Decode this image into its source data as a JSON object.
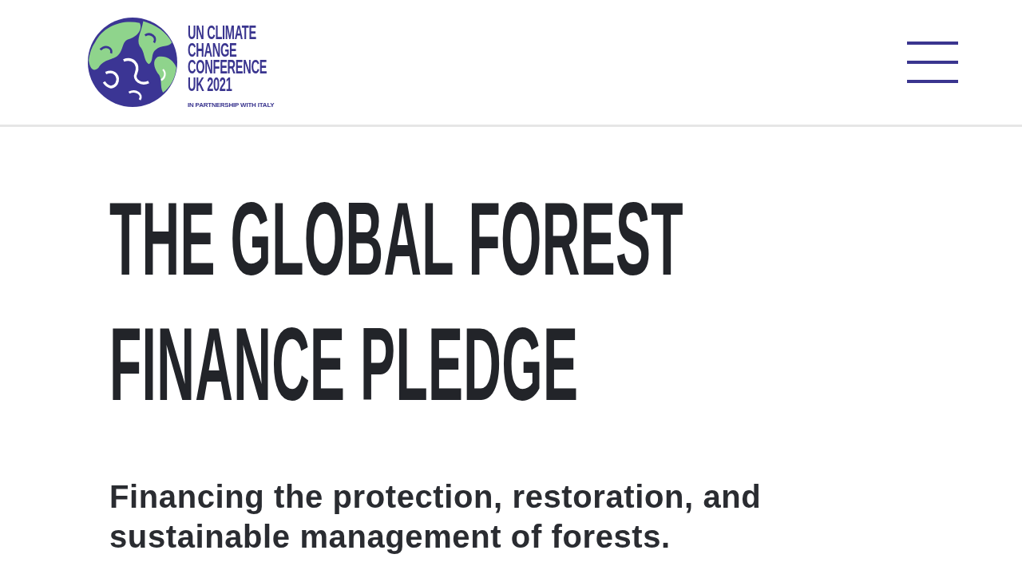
{
  "header": {
    "logo": {
      "lines": [
        "UN CLIMATE",
        "CHANGE",
        "CONFERENCE",
        "UK 2021"
      ],
      "tagline": "IN PARTNERSHIP WITH ITALY"
    }
  },
  "hero": {
    "title": "THE GLOBAL FOREST FINANCE PLEDGE",
    "subtitle": "Financing the protection, restoration, and sustainable management of forests."
  }
}
